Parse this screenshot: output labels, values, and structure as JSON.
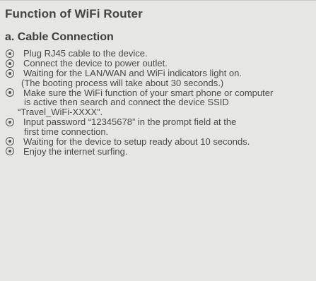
{
  "title": "Function of WiFi Router",
  "section": "a. Cable Connection",
  "items": [
    {
      "lines": [
        "Plug RJ45 cable to the device."
      ]
    },
    {
      "lines": [
        "Connect the device to power outlet."
      ]
    },
    {
      "lines": [
        "Waiting for the LAN/WAN and WiFi indicators light on.",
        "(The booting process will take about 30 seconds.)"
      ]
    },
    {
      "lines": [
        "Make sure the WiFi function of your smart phone or computer",
        "is active then search and connect the device SSID",
        "“Travel_WiFi-XXXX”."
      ]
    },
    {
      "lines": [
        "Input password “12345678” in the prompt field at the",
        "first time connection."
      ]
    },
    {
      "lines": [
        "Waiting for the device to setup ready about 10 seconds."
      ]
    },
    {
      "lines": [
        "Enjoy the internet surfing."
      ]
    }
  ]
}
